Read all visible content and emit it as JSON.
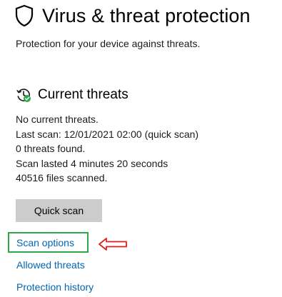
{
  "header": {
    "title": "Virus & threat protection",
    "subtitle": "Protection for your device against threats.",
    "icon": "shield-icon"
  },
  "current_threats": {
    "heading": "Current threats",
    "icon": "clock-check-icon",
    "lines": [
      "No current threats.",
      "Last scan: 12/01/2021 02:00 (quick scan)",
      "0 threats found.",
      "Scan lasted 4 minutes 20 seconds",
      "40516 files scanned."
    ],
    "quick_scan_label": "Quick scan"
  },
  "links": {
    "scan_options": "Scan options",
    "allowed_threats": "Allowed threats",
    "protection_history": "Protection history"
  },
  "annotations": {
    "highlight_color": "#2aa84a",
    "arrow_color": "#e02020",
    "arrow_icon": "left-arrow-icon"
  },
  "colors": {
    "link": "#0066b4",
    "button_bg": "#cccccc",
    "status_green": "#2aa84a"
  }
}
